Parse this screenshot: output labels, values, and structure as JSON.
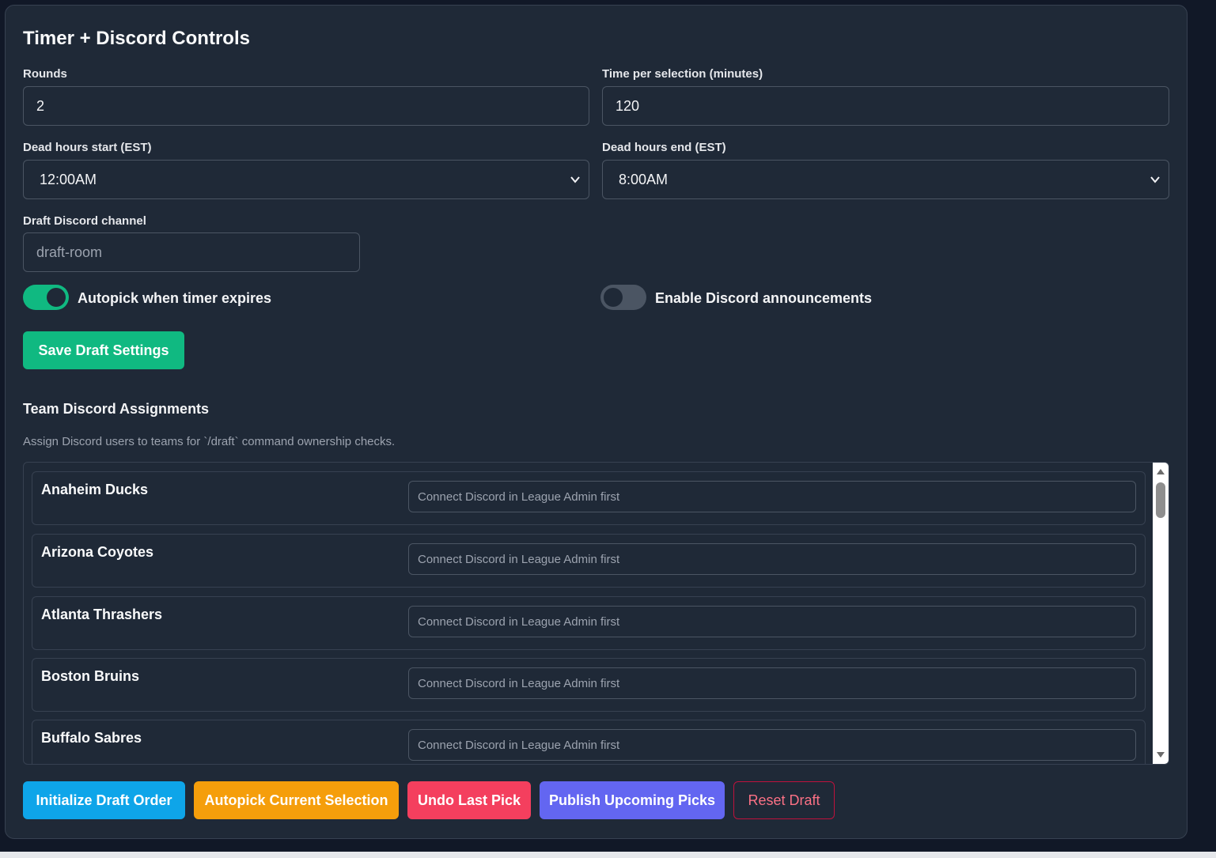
{
  "panel": {
    "title": "Timer + Discord Controls"
  },
  "form": {
    "rounds_label": "Rounds",
    "rounds_value": "2",
    "time_label": "Time per selection (minutes)",
    "time_value": "120",
    "dead_start_label": "Dead hours start (EST)",
    "dead_start_value": "12:00AM",
    "dead_end_label": "Dead hours end (EST)",
    "dead_end_value": "8:00AM",
    "channel_label": "Draft Discord channel",
    "channel_placeholder": "draft-room",
    "autopick_label": "Autopick when timer expires",
    "autopick_enabled": true,
    "announce_label": "Enable Discord announcements",
    "announce_enabled": false,
    "save_label": "Save Draft Settings"
  },
  "assignments": {
    "title": "Team Discord Assignments",
    "description": "Assign Discord users to teams for `/draft` command ownership checks.",
    "input_placeholder": "Connect Discord in League Admin first",
    "teams": [
      {
        "name": "Anaheim Ducks"
      },
      {
        "name": "Arizona Coyotes"
      },
      {
        "name": "Atlanta Thrashers"
      },
      {
        "name": "Boston Bruins"
      },
      {
        "name": "Buffalo Sabres"
      }
    ]
  },
  "actions": {
    "initialize": "Initialize Draft Order",
    "autopick": "Autopick Current Selection",
    "undo": "Undo Last Pick",
    "publish": "Publish Upcoming Picks",
    "reset": "Reset Draft"
  },
  "colors": {
    "panel_bg": "#1f2937",
    "accent_green": "#10b981",
    "initialize": "#0ea5e9",
    "autopick": "#f59e0b",
    "undo": "#f43f5e",
    "publish": "#6366f1",
    "reset_border": "#be123c",
    "reset_text": "#fb7185"
  }
}
